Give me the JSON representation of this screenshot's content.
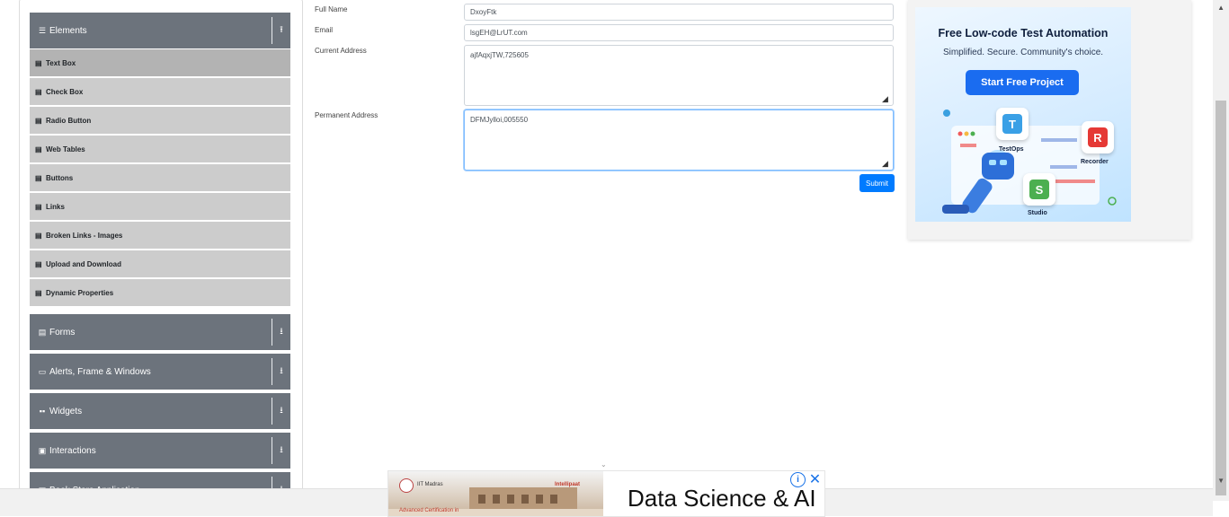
{
  "sidebar": {
    "elements_group": {
      "label": "Elements",
      "icon": "hamburger-icon",
      "toggle_icon": "collapse-up-icon"
    },
    "items": [
      {
        "label": "Text Box",
        "active": true
      },
      {
        "label": "Check Box"
      },
      {
        "label": "Radio Button"
      },
      {
        "label": "Web Tables"
      },
      {
        "label": "Buttons"
      },
      {
        "label": "Links"
      },
      {
        "label": "Broken Links - Images"
      },
      {
        "label": "Upload and Download"
      },
      {
        "label": "Dynamic Properties"
      }
    ],
    "groups": [
      {
        "label": "Forms",
        "icon": "form-icon"
      },
      {
        "label": "Alerts, Frame & Windows",
        "icon": "window-icon"
      },
      {
        "label": "Widgets",
        "icon": "grid-icon"
      },
      {
        "label": "Interactions",
        "icon": "interactions-icon"
      },
      {
        "label": "Book Store Application",
        "icon": "book-icon"
      }
    ]
  },
  "form": {
    "full_name_label": "Full Name",
    "full_name_value": "DxoyFtk",
    "email_label": "Email",
    "email_value": "lsgEH@LrUT.com",
    "current_address_label": "Current Address",
    "current_address_value": "ajfAqxjTW,725605",
    "permanent_address_label": "Permanent Address",
    "permanent_address_value": "DFMJylloi,005550",
    "submit_label": "Submit"
  },
  "ad": {
    "title": "Free Low-code Test Automation",
    "subtitle": "Simplified. Secure. Community's choice.",
    "cta": "Start Free Project",
    "tiles": [
      "TestOps",
      "Recorder",
      "Studio"
    ]
  },
  "banner": {
    "headline": "Data Science & AI",
    "org": "IIT Madras",
    "partner": "Intellipaat",
    "caption": "Advanced Certification in"
  },
  "colors": {
    "accent": "#007bff",
    "sidebar_group": "#6c737c",
    "sidebar_item": "#cccccc"
  }
}
